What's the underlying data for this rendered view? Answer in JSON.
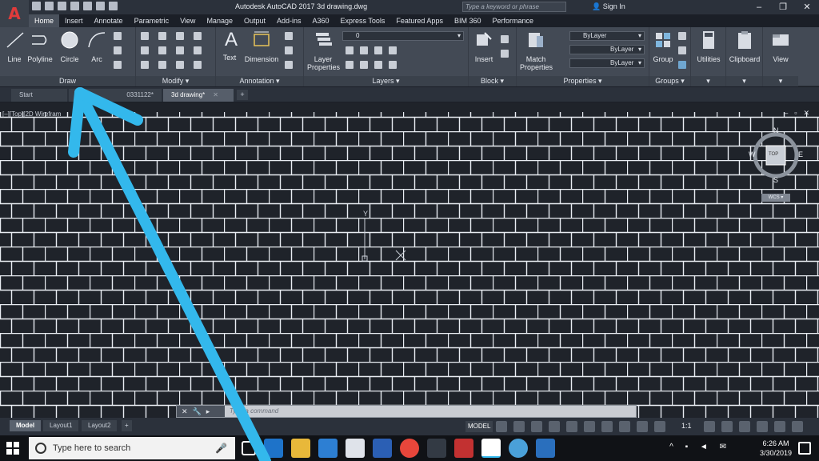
{
  "app": {
    "title": "Autodesk AutoCAD 2017   3d drawing.dwg",
    "search_placeholder": "Type a keyword or phrase",
    "signin": "Sign In"
  },
  "ribbon_tabs": [
    "Home",
    "Insert",
    "Annotate",
    "Parametric",
    "View",
    "Manage",
    "Output",
    "Add-ins",
    "A360",
    "Express Tools",
    "Featured Apps",
    "BIM 360",
    "Performance"
  ],
  "ribbon": {
    "draw_tools": [
      "Line",
      "Polyline",
      "Circle",
      "Arc"
    ],
    "draw_title": "Draw",
    "modify_title": "Modify",
    "annotation_tools": [
      "Text",
      "Dimension"
    ],
    "annotation_title": "Annotation",
    "layer_properties": "Layer Properties",
    "layer_dropdown": "0",
    "layers_title": "Layers",
    "insert": "Insert",
    "block_title": "Block",
    "match_properties": "Match Properties",
    "bylayer_1": "ByLayer",
    "bylayer_2": "ByLayer",
    "bylayer_3": "ByLayer",
    "properties_title": "Properties",
    "group": "Group",
    "groups_title": "Groups",
    "utilities": "Utilities",
    "clipboard": "Clipboard",
    "view": "View"
  },
  "file_tabs": {
    "start": "Start",
    "second": "0331122*",
    "third": "3d drawing*"
  },
  "canvas": {
    "viewport_label": "[–][Top][2D Wirefram",
    "viewcube_top": "TOP",
    "viewcube_n": "N",
    "viewcube_s": "S",
    "viewcube_e": "E",
    "viewcube_w": "W",
    "wcs": "WCS",
    "ucs_y": "Y"
  },
  "command": {
    "prompt": "Type a command"
  },
  "status": {
    "layouts": [
      "Model",
      "Layout1",
      "Layout2"
    ],
    "model_btn": "MODEL",
    "scale": "1:1"
  },
  "taskbar": {
    "search": "Type here to search",
    "time": "6:26 AM",
    "date": "3/30/2019"
  },
  "colors": {
    "brick_bg": "#1f232a",
    "mortar": "#e8ecf2",
    "arrow": "#33b8ec"
  }
}
